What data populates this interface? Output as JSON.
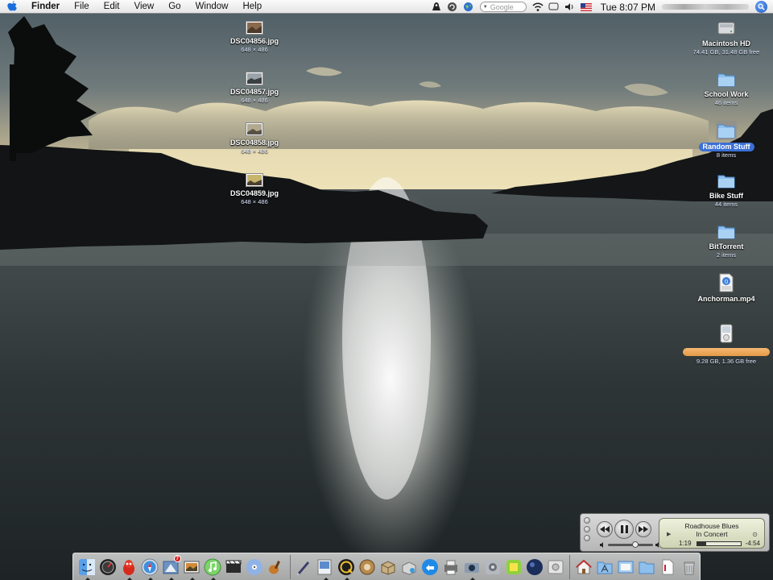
{
  "menubar": {
    "app_name": "Finder",
    "menus": [
      "File",
      "Edit",
      "View",
      "Go",
      "Window",
      "Help"
    ],
    "search_placeholder": "Google",
    "clock": "Tue 8:07 PM",
    "icons": [
      "apple-icon",
      "script-icon",
      "sync-icon",
      "globe-icon",
      "wifi-icon",
      "display-icon",
      "volume-icon",
      "flag-icon",
      "spotlight-icon"
    ]
  },
  "desktop_left": [
    {
      "name": "DSC04856.jpg",
      "info": "648 × 486"
    },
    {
      "name": "DSC04857.jpg",
      "info": "648 × 486"
    },
    {
      "name": "DSC04858.jpg",
      "info": "648 × 486"
    },
    {
      "name": "DSC04859.jpg",
      "info": "648 × 486"
    }
  ],
  "desktop_right": [
    {
      "name": "Macintosh HD",
      "info": "74.41 GB, 31.48 GB free",
      "icon": "hard-drive-icon"
    },
    {
      "name": "School Work",
      "info": "46 items",
      "icon": "folder-icon"
    },
    {
      "name": "Random Stuff",
      "info": "8 items",
      "icon": "folder-icon",
      "selected": true
    },
    {
      "name": "Bike Stuff",
      "info": "44 items",
      "icon": "folder-icon"
    },
    {
      "name": "BitTorrent",
      "info": "2 items",
      "icon": "folder-icon"
    },
    {
      "name": "Anchorman.mp4",
      "info": "",
      "icon": "mpeg-file-icon"
    },
    {
      "name": "",
      "info": "9.28 GB, 1.36 GB free",
      "icon": "ipod-icon"
    }
  ],
  "mini_player": {
    "line1": "Roadhouse Blues",
    "line2": "In Concert",
    "elapsed": "1:19",
    "remaining": "-4:54",
    "progress": 0.21,
    "volume": 0.6
  },
  "dock": {
    "apps": [
      {
        "name": "finder",
        "running": true
      },
      {
        "name": "dashboard",
        "running": false
      },
      {
        "name": "adium",
        "running": true
      },
      {
        "name": "safari",
        "running": true
      },
      {
        "name": "mail",
        "running": true,
        "badge": "7"
      },
      {
        "name": "iphoto",
        "running": true
      },
      {
        "name": "itunes",
        "running": true
      },
      {
        "name": "imovie",
        "running": false
      },
      {
        "name": "idvd",
        "running": false
      },
      {
        "name": "garageband",
        "running": false
      },
      {
        "name": "textedit",
        "running": false
      },
      {
        "name": "preview",
        "running": true
      },
      {
        "name": "quicktime",
        "running": true
      },
      {
        "name": "sherlock",
        "running": false
      },
      {
        "name": "bittorrent",
        "running": false
      },
      {
        "name": "network-utility",
        "running": false
      },
      {
        "name": "software-update",
        "running": false
      },
      {
        "name": "printer",
        "running": false
      },
      {
        "name": "grab",
        "running": true
      },
      {
        "name": "system-preferences",
        "running": false
      },
      {
        "name": "chess",
        "running": false
      },
      {
        "name": "sphere",
        "running": false
      },
      {
        "name": "disk-utility",
        "running": false
      }
    ],
    "docs": [
      "home",
      "applications",
      "documents",
      "folder",
      "pdf",
      "trash"
    ]
  }
}
